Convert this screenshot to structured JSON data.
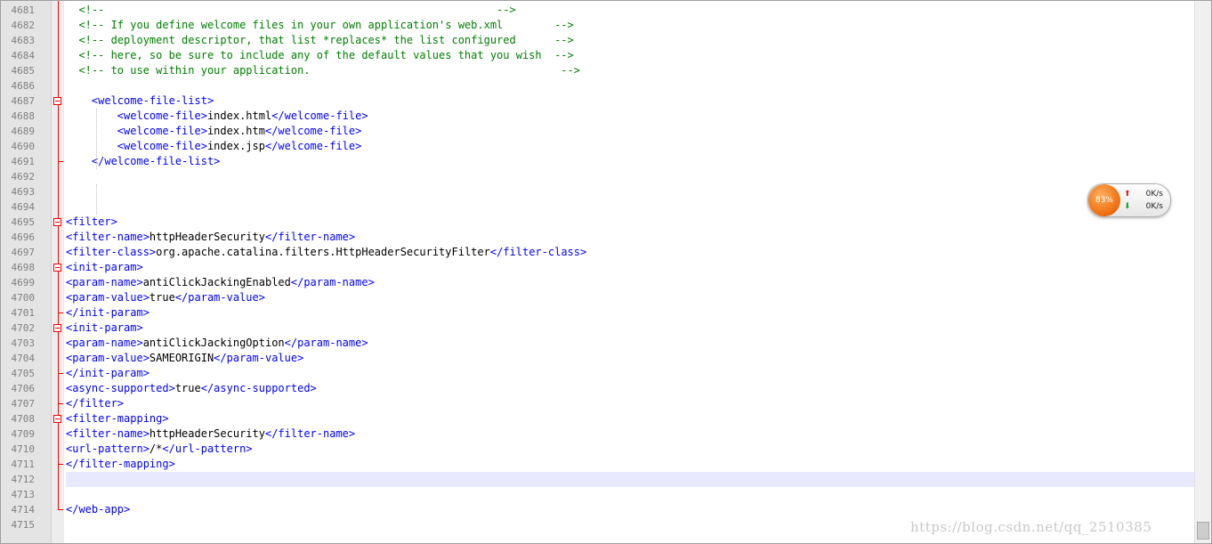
{
  "editor": {
    "lines": [
      {
        "num": "4681",
        "parts": [
          [
            "c-comment",
            "  <!--                                                             -->"
          ]
        ]
      },
      {
        "num": "4682",
        "parts": [
          [
            "c-comment",
            "  <!-- If you define welcome files in your own application's web.xml        -->"
          ]
        ]
      },
      {
        "num": "4683",
        "parts": [
          [
            "c-comment",
            "  <!-- deployment descriptor, that list *replaces* the list configured      -->"
          ]
        ]
      },
      {
        "num": "4684",
        "parts": [
          [
            "c-comment",
            "  <!-- here, so be sure to include any of the default values that you wish  -->"
          ]
        ]
      },
      {
        "num": "4685",
        "parts": [
          [
            "c-comment",
            "  <!-- to use within your application.                                       -->"
          ]
        ]
      },
      {
        "num": "4686",
        "parts": []
      },
      {
        "num": "4687",
        "parts": [
          [
            "c-text",
            "    "
          ],
          [
            "c-tag",
            "<welcome-file-list>"
          ]
        ]
      },
      {
        "num": "4688",
        "parts": [
          [
            "c-text",
            "        "
          ],
          [
            "c-tag",
            "<welcome-file>"
          ],
          [
            "c-text",
            "index.html"
          ],
          [
            "c-tag",
            "</welcome-file>"
          ]
        ]
      },
      {
        "num": "4689",
        "parts": [
          [
            "c-text",
            "        "
          ],
          [
            "c-tag",
            "<welcome-file>"
          ],
          [
            "c-text",
            "index.htm"
          ],
          [
            "c-tag",
            "</welcome-file>"
          ]
        ]
      },
      {
        "num": "4690",
        "parts": [
          [
            "c-text",
            "        "
          ],
          [
            "c-tag",
            "<welcome-file>"
          ],
          [
            "c-text",
            "index.jsp"
          ],
          [
            "c-tag",
            "</welcome-file>"
          ]
        ]
      },
      {
        "num": "4691",
        "parts": [
          [
            "c-text",
            "    "
          ],
          [
            "c-tag",
            "</welcome-file-list>"
          ]
        ]
      },
      {
        "num": "4692",
        "parts": []
      },
      {
        "num": "4693",
        "parts": []
      },
      {
        "num": "4694",
        "parts": []
      },
      {
        "num": "4695",
        "parts": [
          [
            "c-tag",
            "<filter>"
          ]
        ]
      },
      {
        "num": "4696",
        "parts": [
          [
            "c-tag",
            "<filter-name>"
          ],
          [
            "c-text",
            "httpHeaderSecurity"
          ],
          [
            "c-tag",
            "</filter-name>"
          ]
        ]
      },
      {
        "num": "4697",
        "parts": [
          [
            "c-tag",
            "<filter-class>"
          ],
          [
            "c-text",
            "org.apache.catalina.filters.HttpHeaderSecurityFilter"
          ],
          [
            "c-tag",
            "</filter-class>"
          ]
        ]
      },
      {
        "num": "4698",
        "parts": [
          [
            "c-tag",
            "<init-param>"
          ]
        ]
      },
      {
        "num": "4699",
        "parts": [
          [
            "c-tag",
            "<param-name>"
          ],
          [
            "c-text",
            "antiClickJackingEnabled"
          ],
          [
            "c-tag",
            "</param-name>"
          ]
        ]
      },
      {
        "num": "4700",
        "parts": [
          [
            "c-tag",
            "<param-value>"
          ],
          [
            "c-text",
            "true"
          ],
          [
            "c-tag",
            "</param-value>"
          ]
        ]
      },
      {
        "num": "4701",
        "parts": [
          [
            "c-tag",
            "</init-param>"
          ]
        ]
      },
      {
        "num": "4702",
        "parts": [
          [
            "c-tag",
            "<init-param>"
          ]
        ]
      },
      {
        "num": "4703",
        "parts": [
          [
            "c-tag",
            "<param-name>"
          ],
          [
            "c-text",
            "antiClickJackingOption"
          ],
          [
            "c-tag",
            "</param-name>"
          ]
        ]
      },
      {
        "num": "4704",
        "parts": [
          [
            "c-tag",
            "<param-value>"
          ],
          [
            "c-text",
            "SAMEORIGIN"
          ],
          [
            "c-tag",
            "</param-value>"
          ]
        ]
      },
      {
        "num": "4705",
        "parts": [
          [
            "c-tag",
            "</init-param>"
          ]
        ]
      },
      {
        "num": "4706",
        "parts": [
          [
            "c-tag",
            "<async-supported>"
          ],
          [
            "c-text",
            "true"
          ],
          [
            "c-tag",
            "</async-supported>"
          ]
        ]
      },
      {
        "num": "4707",
        "parts": [
          [
            "c-tag",
            "</filter>"
          ]
        ]
      },
      {
        "num": "4708",
        "parts": [
          [
            "c-tag",
            "<filter-mapping>"
          ]
        ]
      },
      {
        "num": "4709",
        "parts": [
          [
            "c-tag",
            "<filter-name>"
          ],
          [
            "c-text",
            "httpHeaderSecurity"
          ],
          [
            "c-tag",
            "</filter-name>"
          ]
        ]
      },
      {
        "num": "4710",
        "parts": [
          [
            "c-tag",
            "<url-pattern>"
          ],
          [
            "c-text",
            "/*"
          ],
          [
            "c-tag",
            "</url-pattern>"
          ]
        ]
      },
      {
        "num": "4711",
        "parts": [
          [
            "c-tag",
            "</filter-mapping>"
          ]
        ]
      },
      {
        "num": "4712",
        "parts": [],
        "current": true
      },
      {
        "num": "4713",
        "parts": []
      },
      {
        "num": "4714",
        "parts": [
          [
            "c-tag",
            "</web-app>"
          ]
        ]
      },
      {
        "num": "4715",
        "parts": []
      }
    ],
    "colors": {
      "comment": "#008000",
      "tag": "#0000ff",
      "text": "#000000",
      "fold_marker": "#ff0000",
      "current_line": "#e8e8ff"
    }
  },
  "net_monitor": {
    "percent": "83%",
    "upload_rate": "0K/s",
    "download_rate": "0K/s",
    "up_icon": "arrow-up-icon",
    "down_icon": "arrow-down-icon"
  },
  "watermark": {
    "text": "https://blog.csdn.net/qq_2510385"
  }
}
